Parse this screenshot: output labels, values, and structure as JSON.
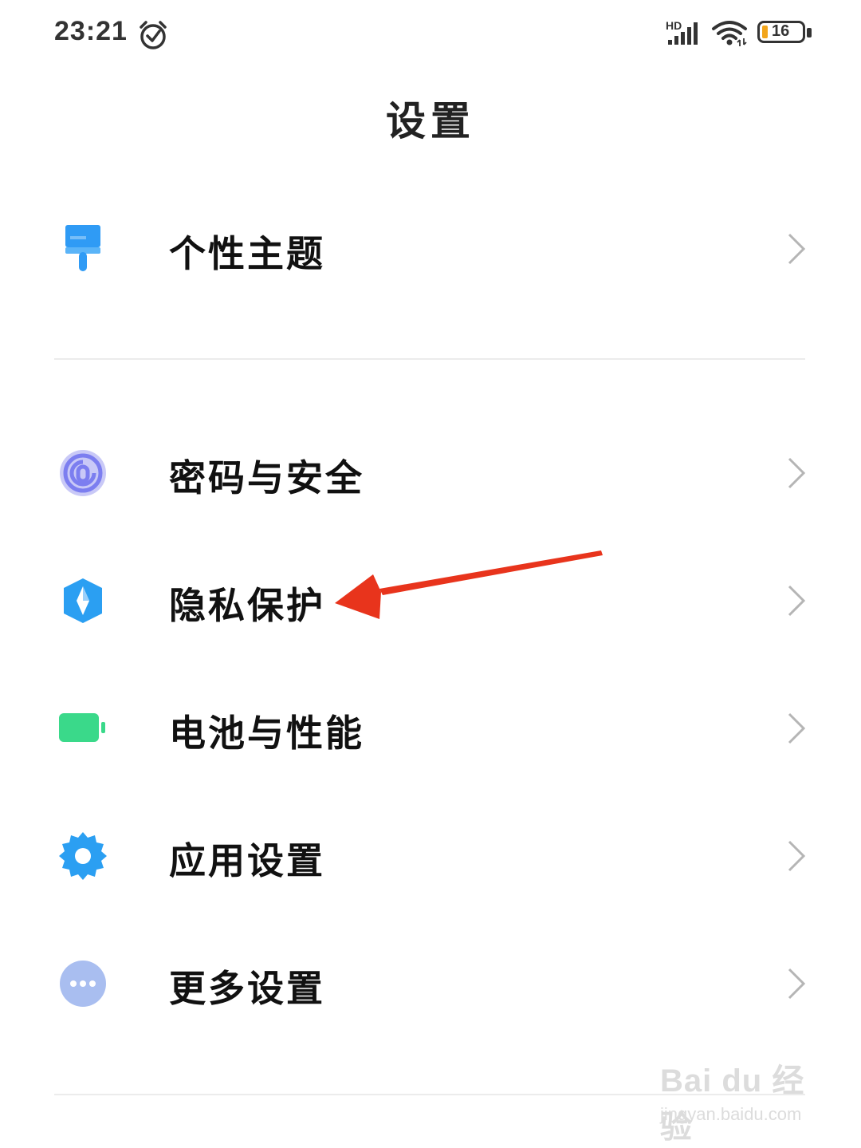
{
  "status_bar": {
    "time": "23:21",
    "network_label": "HD",
    "battery_level": "16",
    "icons": [
      "alarm-icon",
      "signal-icon",
      "wifi-icon",
      "battery-icon"
    ]
  },
  "header": {
    "title": "设置"
  },
  "sections": [
    {
      "items": [
        {
          "label": "个性主题",
          "icon": "theme-brush-icon",
          "icon_color": "#2f9bf5"
        }
      ]
    },
    {
      "items": [
        {
          "label": "密码与安全",
          "icon": "fingerprint-icon",
          "icon_color": "#7c7ef0"
        },
        {
          "label": "隐私保护",
          "icon": "privacy-shield-icon",
          "icon_color": "#2b9ff2"
        },
        {
          "label": "电池与性能",
          "icon": "battery-icon",
          "icon_color": "#3ad98a"
        },
        {
          "label": "应用设置",
          "icon": "gear-icon",
          "icon_color": "#2b9ff2"
        },
        {
          "label": "更多设置",
          "icon": "more-dots-icon",
          "icon_color": "#a9bef0"
        }
      ]
    }
  ],
  "annotation": {
    "type": "arrow",
    "color": "#e8341c",
    "points_to": "隐私保护"
  },
  "watermark": {
    "logo": "Bai du 经验",
    "url": "jingyan.baidu.com"
  }
}
